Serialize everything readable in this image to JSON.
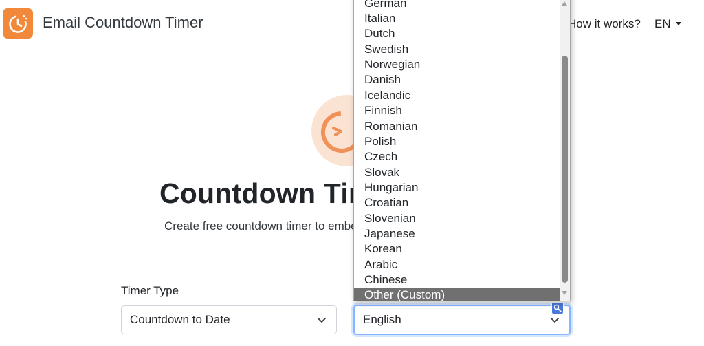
{
  "header": {
    "brand": "Email Countdown Timer",
    "how_it_works": "How it works?",
    "language_code": "EN"
  },
  "hero": {
    "title": "Countdown Timer",
    "subtitle": "Create free countdown timer to embed in your email"
  },
  "form": {
    "timer_type_label": "Timer Type",
    "timer_type_value": "Countdown to Date",
    "language_value": "English"
  },
  "language_dropdown": {
    "options": [
      "German",
      "Italian",
      "Dutch",
      "Swedish",
      "Norwegian",
      "Danish",
      "Icelandic",
      "Finnish",
      "Romanian",
      "Polish",
      "Czech",
      "Slovak",
      "Hungarian",
      "Croatian",
      "Slovenian",
      "Japanese",
      "Korean",
      "Arabic",
      "Chinese",
      "Other (Custom)"
    ],
    "highlighted": "Other (Custom)"
  },
  "colors": {
    "accent": "#f2883a",
    "highlight": "#707070",
    "focus_ring": "#86b7fe"
  },
  "icons": {
    "logo": "clock-timer-icon",
    "hero": "clock-timer-icon",
    "select_arrow": "chevron-down-icon",
    "nav_caret": "caret-down-icon",
    "translate": "translate-icon"
  }
}
